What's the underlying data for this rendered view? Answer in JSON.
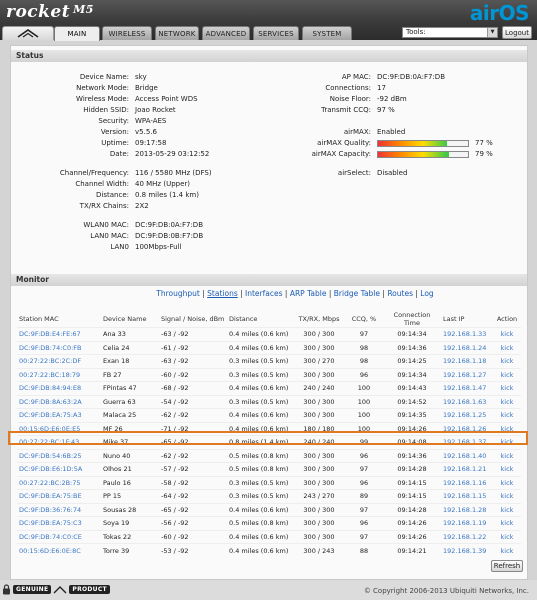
{
  "banner": {
    "brand": "rocket",
    "model": "M5",
    "os": "airOS"
  },
  "tabs": [
    {
      "label": "MAIN",
      "active": true
    },
    {
      "label": "WIRELESS"
    },
    {
      "label": "NETWORK"
    },
    {
      "label": "ADVANCED"
    },
    {
      "label": "SERVICES"
    },
    {
      "label": "SYSTEM"
    }
  ],
  "tools": {
    "label": "Tools:",
    "value": ""
  },
  "logout": "Logout",
  "status": {
    "title": "Status",
    "left": [
      {
        "label": "Device Name:",
        "value": "sky"
      },
      {
        "label": "Network Mode:",
        "value": "Bridge"
      },
      {
        "label": "Wireless Mode:",
        "value": "Access Point WDS"
      },
      {
        "label": "Hidden SSID:",
        "value": "Joao Rocket"
      },
      {
        "label": "Security:",
        "value": "WPA-AES"
      },
      {
        "label": "Version:",
        "value": "v5.5.6"
      },
      {
        "label": "Uptime:",
        "value": "09:17:58"
      },
      {
        "label": "Date:",
        "value": "2013-05-29 03:12:52"
      },
      {
        "label": "Channel/Frequency:",
        "value": "116 / 5580 MHz (DFS)"
      },
      {
        "label": "Channel Width:",
        "value": "40 MHz (Upper)"
      },
      {
        "label": "Distance:",
        "value": "0.8 miles (1.4 km)"
      },
      {
        "label": "TX/RX Chains:",
        "value": "2X2"
      },
      {
        "label": "WLAN0 MAC:",
        "value": "DC:9F:DB:0A:F7:DB"
      },
      {
        "label": "LAN0 MAC:",
        "value": "DC:9F:DB:0B:F7:DB"
      },
      {
        "label": "LAN0",
        "value": "100Mbps-Full"
      }
    ],
    "right": [
      {
        "label": "AP MAC:",
        "value": "DC:9F:DB:0A:F7:DB"
      },
      {
        "label": "Connections:",
        "value": "17"
      },
      {
        "label": "Noise Floor:",
        "value": "-92 dBm"
      },
      {
        "label": "Transmit CCQ:",
        "value": "97 %"
      },
      {
        "label": "airMAX:",
        "value": "Enabled"
      },
      {
        "label": "airMAX Quality:",
        "value": "77 %",
        "level": 0.77
      },
      {
        "label": "airMAX Capacity:",
        "value": "79 %",
        "level": 0.79
      },
      {
        "label": "airSelect:",
        "value": "Disabled"
      }
    ]
  },
  "monitor": {
    "title": "Monitor",
    "links": [
      "Throughput",
      "Stations",
      "Interfaces",
      "ARP Table",
      "Bridge Table",
      "Routes",
      "Log"
    ],
    "columns": [
      "Station MAC",
      "Device Name",
      "Signal / Noise, dBm",
      "Distance",
      "TX/RX, Mbps",
      "CCQ, %",
      "Connection Time",
      "Last IP",
      "Action"
    ],
    "rows": [
      [
        "DC:9F:DB:E4:FE:67",
        "Ana 33",
        "-63 / -92",
        "0.4 miles (0.6 km)",
        "300 / 300",
        "97",
        "09:14:34",
        "192.168.1.33",
        "kick"
      ],
      [
        "DC:9F:DB:74:C0:FB",
        "Celia 24",
        "-61 / -92",
        "0.4 miles (0.6 km)",
        "300 / 300",
        "98",
        "09:14:36",
        "192.168.1.24",
        "kick"
      ],
      [
        "00:27:22:BC:2C:DF",
        "Exan 18",
        "-63 / -92",
        "0.3 miles (0.5 km)",
        "300 / 270",
        "98",
        "09:14:25",
        "192.168.1.18",
        "kick"
      ],
      [
        "00:27:22:BC:18:79",
        "FB 27",
        "-60 / -92",
        "0.3 miles (0.5 km)",
        "300 / 300",
        "96",
        "09:14:34",
        "192.168.1.27",
        "kick"
      ],
      [
        "DC:9F:DB:84:94:E8",
        "FPintas 47",
        "-68 / -92",
        "0.4 miles (0.6 km)",
        "240 / 240",
        "100",
        "09:14:43",
        "192.168.1.47",
        "kick"
      ],
      [
        "DC:9F:DB:8A:63:2A",
        "Guerra 63",
        "-54 / -92",
        "0.3 miles (0.5 km)",
        "300 / 300",
        "100",
        "09:14:52",
        "192.168.1.63",
        "kick"
      ],
      [
        "DC:9F:DB:EA:75:A3",
        "Malaca 25",
        "-62 / -92",
        "0.4 miles (0.6 km)",
        "300 / 300",
        "100",
        "09:14:35",
        "192.168.1.25",
        "kick"
      ],
      [
        "00:15:6D:E6:0E:E5",
        "MF 26",
        "-71 / -92",
        "0.4 miles (0.6 km)",
        "180 / 180",
        "100",
        "09:14:26",
        "192.168.1.26",
        "kick"
      ],
      [
        "00:27:22:BC:1F:43",
        "Mike 37",
        "-65 / -92",
        "0.8 miles (1.4 km)",
        "240 / 240",
        "99",
        "09:14:08",
        "192.168.1.37",
        "kick"
      ],
      [
        "DC:9F:DB:54:6B:25",
        "Nuno 40",
        "-62 / -92",
        "0.5 miles (0.8 km)",
        "300 / 300",
        "96",
        "09:14:36",
        "192.168.1.40",
        "kick"
      ],
      [
        "DC:9F:DB:E6:1D:5A",
        "Olhos 21",
        "-57 / -92",
        "0.5 miles (0.8 km)",
        "300 / 300",
        "97",
        "09:14:28",
        "192.168.1.21",
        "kick"
      ],
      [
        "00:27:22:BC:2B:75",
        "Paulo 16",
        "-58 / -92",
        "0.3 miles (0.5 km)",
        "300 / 300",
        "96",
        "09:14:15",
        "192.168.1.16",
        "kick"
      ],
      [
        "DC:9F:DB:EA:75:BE",
        "PP 15",
        "-64 / -92",
        "0.3 miles (0.5 km)",
        "243 / 270",
        "89",
        "09:14:15",
        "192.168.1.15",
        "kick"
      ],
      [
        "DC:9F:DB:36:76:74",
        "Sousas 28",
        "-65 / -92",
        "0.4 miles (0.6 km)",
        "300 / 300",
        "97",
        "09:14:28",
        "192.168.1.28",
        "kick"
      ],
      [
        "DC:9F:DB:EA:75:C3",
        "Soya 19",
        "-56 / -92",
        "0.5 miles (0.8 km)",
        "300 / 300",
        "96",
        "09:14:26",
        "192.168.1.19",
        "kick"
      ],
      [
        "DC:9F:DB:74:C0:CE",
        "Tokas 22",
        "-60 / -92",
        "0.4 miles (0.6 km)",
        "300 / 300",
        "97",
        "09:14:26",
        "192.168.1.22",
        "kick"
      ],
      [
        "00:15:6D:E6:0E:8C",
        "Torre 39",
        "-53 / -92",
        "0.4 miles (0.6 km)",
        "300 / 243",
        "88",
        "09:14:21",
        "192.168.1.39",
        "kick"
      ]
    ],
    "refresh": "Refresh"
  },
  "footer": {
    "badge_left": "GENUINE",
    "badge_right": "PRODUCT",
    "copyright": "© Copyright 2006-2013 Ubiquiti Networks, Inc."
  }
}
